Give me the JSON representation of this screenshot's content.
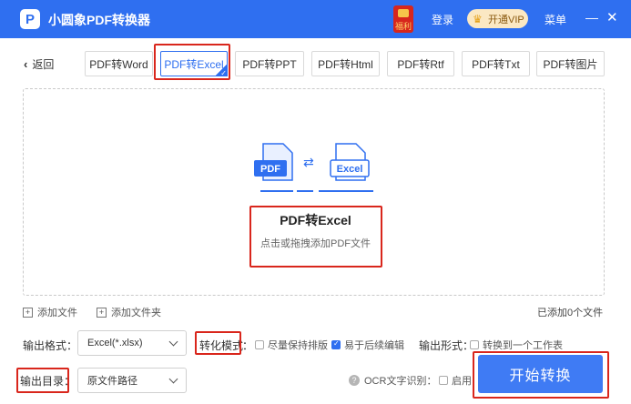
{
  "app": {
    "logo_glyph": "P",
    "title": "小圆象PDF转换器",
    "fuli_label": "福利",
    "login_label": "登录",
    "vip_label": "开通VIP",
    "menu_label": "菜单",
    "minimize_glyph": "—",
    "close_glyph": "✕"
  },
  "nav": {
    "back_label": "返回",
    "tabs": [
      {
        "label": "PDF转Word"
      },
      {
        "label": "PDF转Excel",
        "active": true
      },
      {
        "label": "PDF转PPT"
      },
      {
        "label": "PDF转Html"
      },
      {
        "label": "PDF转Rtf"
      },
      {
        "label": "PDF转Txt"
      },
      {
        "label": "PDF转图片"
      }
    ]
  },
  "dropzone": {
    "source_icon_text": "PDF",
    "target_icon_text": "Excel",
    "title": "PDF转Excel",
    "hint": "点击或拖拽添加PDF文件"
  },
  "actions": {
    "add_file_label": "添加文件",
    "add_folder_label": "添加文件夹",
    "added_count_text": "已添加0个文件"
  },
  "options": {
    "output_format_label": "输出格式：",
    "output_format_value": "Excel(*.xlsx)",
    "convert_mode_label": "转化模式",
    "convert_mode_colon": "：",
    "mode_keep_layout": "尽量保持排版",
    "mode_keep_layout_checked": false,
    "mode_easy_edit": "易于后续编辑",
    "mode_easy_edit_checked": true,
    "output_form_label": "输出形式：",
    "output_one_sheet": "转换到一个工作表",
    "output_one_sheet_checked": false,
    "output_dir_label": "输出目录",
    "output_dir_colon": "：",
    "output_dir_value": "原文件路径",
    "ocr_label": "OCR文字识别：",
    "ocr_enable": "启用",
    "ocr_enable_checked": false,
    "start_button": "开始转换"
  },
  "colors": {
    "brand_blue": "#2f6ff0",
    "highlight_red": "#d9261c",
    "button_blue": "#3f7bf4"
  }
}
